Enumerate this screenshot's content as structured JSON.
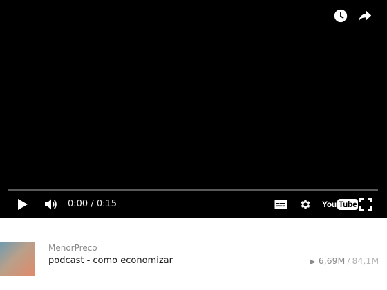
{
  "player": {
    "background": "#000000",
    "time_current": "0:00",
    "time_separator": "/",
    "time_total": "0:15",
    "progress": 0,
    "icons": {
      "watch_later": "clock-icon",
      "share": "share-icon",
      "play": "play-icon",
      "volume": "volume-icon",
      "captions": "subtitles-icon",
      "settings": "gear-icon",
      "fullscreen": "fullscreen-icon"
    },
    "logo": {
      "you": "You",
      "tube": "Tube"
    }
  },
  "info": {
    "channel": "MenorPreco",
    "title": "podcast - como economizar",
    "views": "6,69M",
    "stats_separator": "/",
    "total": "84,1M",
    "accent": "#8a8a8a"
  }
}
